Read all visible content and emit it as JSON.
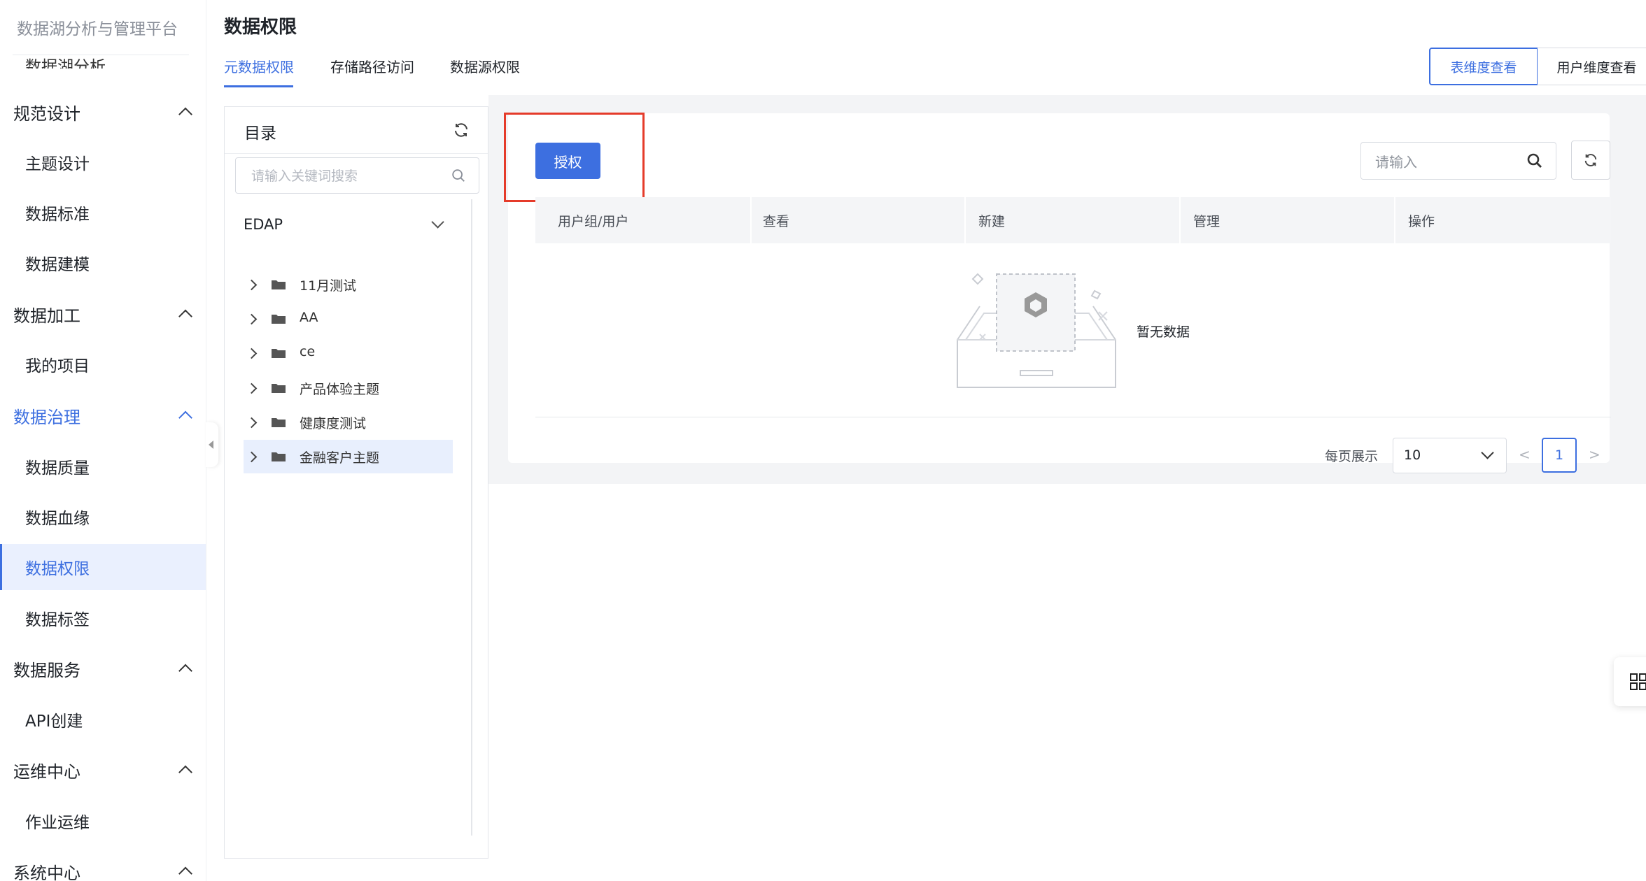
{
  "app": {
    "title": "数据湖分析与管理平台"
  },
  "sidebar": {
    "cut_item": "数据湖分析",
    "groups": [
      {
        "label": "规范设计",
        "items": [
          "主题设计",
          "数据标准",
          "数据建模"
        ]
      },
      {
        "label": "数据加工",
        "items": [
          "我的项目"
        ]
      },
      {
        "label": "数据治理",
        "items": [
          "数据质量",
          "数据血缘",
          "数据权限",
          "数据标签"
        ]
      },
      {
        "label": "数据服务",
        "items": [
          "API创建"
        ]
      },
      {
        "label": "运维中心",
        "items": [
          "作业运维"
        ]
      },
      {
        "label": "系统中心",
        "items": []
      }
    ],
    "active_item": "数据权限"
  },
  "header": {
    "title": "数据权限",
    "tabs": [
      "元数据权限",
      "存储路径访问",
      "数据源权限"
    ],
    "active_tab": "元数据权限",
    "view_toggle": [
      "表维度查看",
      "用户维度查看"
    ],
    "active_view": "表维度查看"
  },
  "directory": {
    "title": "目录",
    "search_placeholder": "请输入关键词搜索",
    "root": "EDAP",
    "nodes": [
      "11月测试",
      "AA",
      "ce",
      "产品体验主题",
      "健康度测试",
      "金融客户主题"
    ],
    "selected_node": "金融客户主题"
  },
  "main": {
    "authorize_button": "授权",
    "search_placeholder": "请输入",
    "columns": [
      "用户组/用户",
      "查看",
      "新建",
      "管理",
      "操作"
    ],
    "empty_text": "暂无数据",
    "pagination": {
      "page_size_label": "每页展示",
      "page_size": "10",
      "prev": "<",
      "current_page": "1",
      "next": ">"
    }
  },
  "colors": {
    "accent": "#3d6fe0",
    "highlight_box": "#e53b2a",
    "selected_bg": "#eaf0fe",
    "panel_bg": "#f3f4f6"
  },
  "icons": [
    "chevron-up-icon",
    "refresh-icon",
    "search-icon",
    "chevron-down-icon",
    "chevron-right-icon",
    "folder-icon",
    "empty-box-icon",
    "grid-icon",
    "collapse-arrow-icon"
  ]
}
